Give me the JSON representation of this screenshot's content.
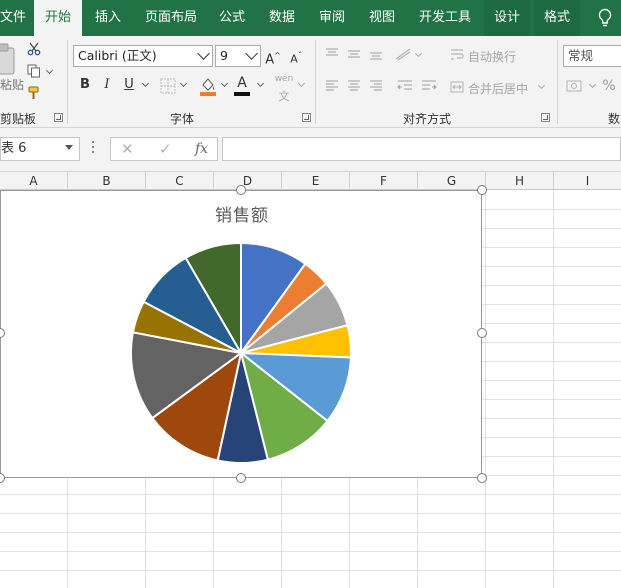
{
  "tabs": [
    {
      "label": "文件",
      "active": false,
      "contextual": false
    },
    {
      "label": "开始",
      "active": true,
      "contextual": false
    },
    {
      "label": "插入",
      "active": false,
      "contextual": false
    },
    {
      "label": "页面布局",
      "active": false,
      "contextual": false
    },
    {
      "label": "公式",
      "active": false,
      "contextual": false
    },
    {
      "label": "数据",
      "active": false,
      "contextual": false
    },
    {
      "label": "审阅",
      "active": false,
      "contextual": false
    },
    {
      "label": "视图",
      "active": false,
      "contextual": false
    },
    {
      "label": "开发工具",
      "active": false,
      "contextual": false
    },
    {
      "label": "设计",
      "active": false,
      "contextual": true
    },
    {
      "label": "格式",
      "active": false,
      "contextual": true
    }
  ],
  "ribbon": {
    "clipboard": {
      "label": "剪贴板",
      "paste_label": "粘贴"
    },
    "font": {
      "label": "字体",
      "font_name": "Calibri (正文)",
      "font_size": "9",
      "bold": "B",
      "italic": "I",
      "underline": "U",
      "grow": "A",
      "shrink": "A",
      "font_color_glyph": "A",
      "phonetic_glyph": "wén"
    },
    "alignment": {
      "label": "对齐方式",
      "wrap_text": "自动换行",
      "merge_center": "合并后居中"
    },
    "number": {
      "label": "数",
      "format": "常规",
      "percent": "%"
    }
  },
  "formula_bar": {
    "name_box": "表 6",
    "cancel": "✕",
    "enter": "✓",
    "fx": "fx",
    "value": ""
  },
  "columns": [
    "A",
    "B",
    "C",
    "D",
    "E",
    "F",
    "G",
    "H",
    "I"
  ],
  "chart_data": {
    "type": "pie",
    "title": "销售额",
    "legend": "none",
    "slices": [
      {
        "value": 9.5,
        "color": "#4472c4"
      },
      {
        "value": 4.0,
        "color": "#ed7d31"
      },
      {
        "value": 6.5,
        "color": "#a5a5a5"
      },
      {
        "value": 4.5,
        "color": "#ffc000"
      },
      {
        "value": 9.5,
        "color": "#5b9bd5"
      },
      {
        "value": 10.0,
        "color": "#70ad47"
      },
      {
        "value": 7.0,
        "color": "#264478"
      },
      {
        "value": 11.0,
        "color": "#9e480e"
      },
      {
        "value": 12.5,
        "color": "#636363"
      },
      {
        "value": 4.5,
        "color": "#997300"
      },
      {
        "value": 8.5,
        "color": "#255e91"
      },
      {
        "value": 8.0,
        "color": "#43682b"
      }
    ]
  },
  "colors": {
    "excel_green": "#217346",
    "ribbon_bg": "#f3f3f3"
  }
}
